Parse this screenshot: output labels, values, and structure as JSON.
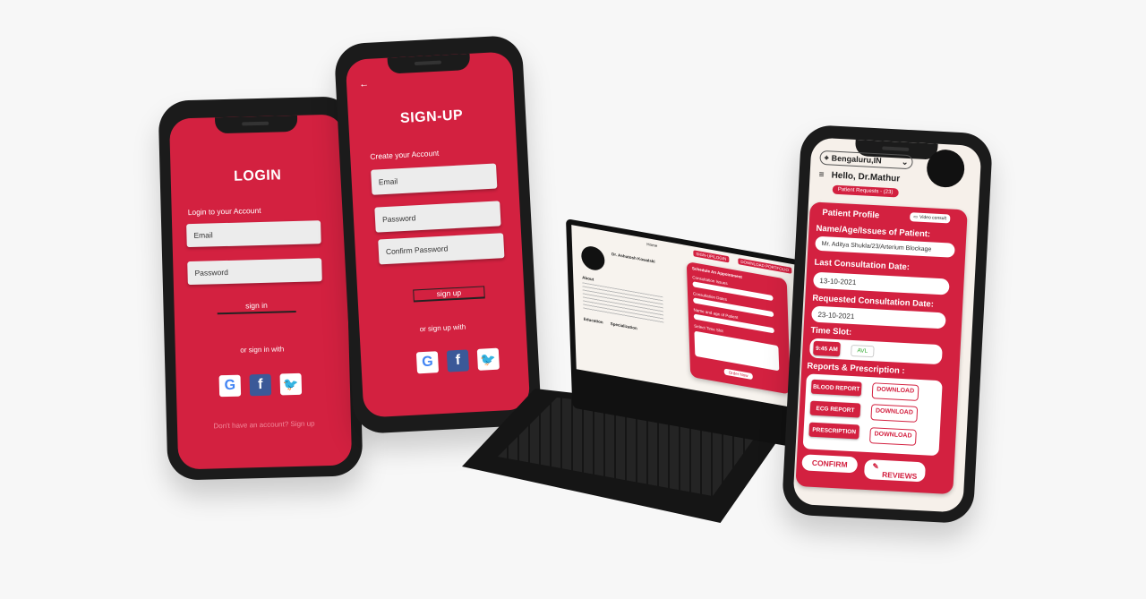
{
  "login": {
    "title": "LOGIN",
    "subtitle": "Login to your Account",
    "email_placeholder": "Email",
    "password_placeholder": "Password",
    "signin_label": "sign in",
    "alt_label": "or sign in with",
    "signup_prompt": "Don't have an account? Sign up"
  },
  "signup": {
    "back_icon": "arrow-left-icon",
    "title": "SIGN-UP",
    "subtitle": "Create your Account",
    "email_placeholder": "Email",
    "password_placeholder": "Password",
    "confirm_placeholder": "Confirm Password",
    "signup_label": "sign up",
    "alt_label": "or sign up with"
  },
  "social": {
    "google": "G",
    "facebook": "f",
    "twitter": "🐦"
  },
  "laptop": {
    "nav_home": "Home",
    "nav_signup": "SIGN-UP/LOGIN",
    "nav_download": "DOWNLOAD PORTFOLIO",
    "doctor_name": "Dr. Ashutosh Kowalski",
    "about_label": "About",
    "education_label": "Education",
    "specialization_label": "Specialization",
    "form_title": "Schedule An Appointment",
    "field1": "Consultation Issues",
    "field2": "Consultation Dates",
    "field3": "Name and age of Patient",
    "field4": "Select Time Slot",
    "submit_label": "Order Now"
  },
  "dashboard": {
    "location": "Bengaluru,IN",
    "greeting": "Hello, Dr.Mathur",
    "requests_badge": "Patient Requests - (23)",
    "profile_title": "Patient Profile",
    "video_consult": "Video consult",
    "name_label": "Name/Age/Issues of Patient:",
    "name_value": "Mr. Aditya Shukla/23/Arterium Blockage",
    "last_label": "Last Consultation Date:",
    "last_value": "13-10-2021",
    "req_label": "Requested Consultation Date:",
    "req_value": "23-10-2021",
    "slot_label": "Time Slot:",
    "slot_time": "9:45 AM",
    "slot_avl": "AVL",
    "reports_label": "Reports & Prescription :",
    "reports": [
      {
        "name": "BLOOD REPORT",
        "action": "DOWNLOAD"
      },
      {
        "name": "ECG REPORT",
        "action": "DOWNLOAD"
      },
      {
        "name": "PRESCRIPTION",
        "action": "DOWNLOAD"
      }
    ],
    "confirm_label": "CONFIRM",
    "reviews_label": "REVIEWS"
  },
  "colors": {
    "brand_red": "#d32140",
    "cream": "#f6f0ea",
    "phone_body": "#1b1b1b"
  }
}
